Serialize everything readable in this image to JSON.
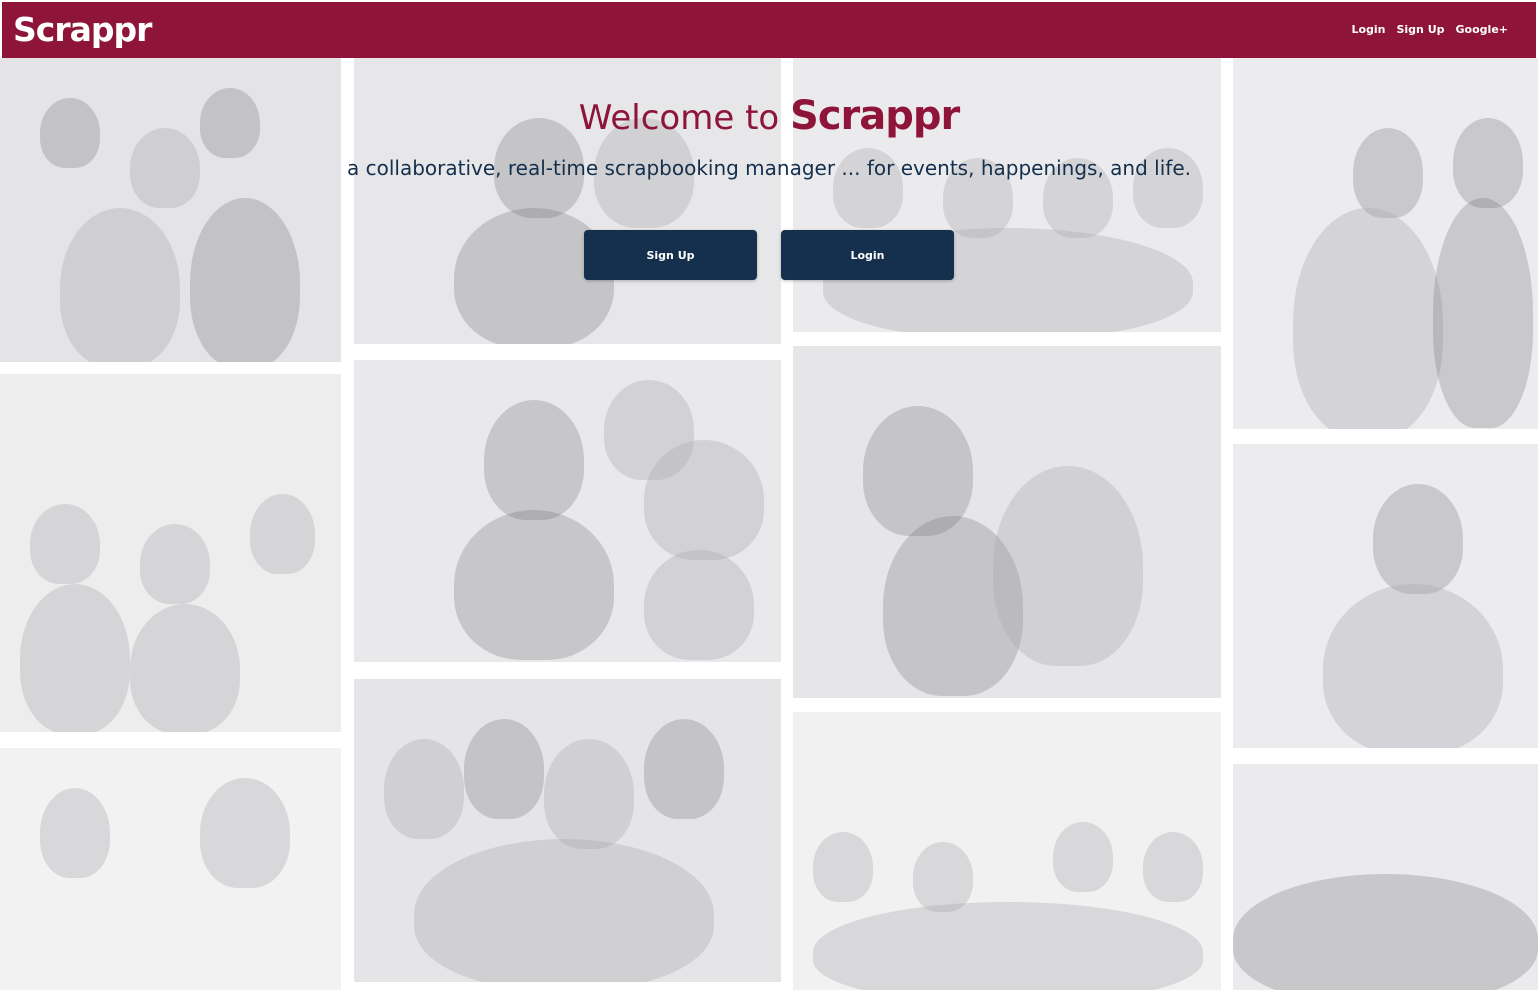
{
  "navbar": {
    "logo": "Scrappr",
    "brand_color": "#8f1439",
    "links": [
      {
        "label": "Login"
      },
      {
        "label": "Sign Up"
      },
      {
        "label": "Google+"
      }
    ]
  },
  "hero": {
    "title_prefix": "Welcome to ",
    "title_brand": "Scrappr",
    "subtitle": "a collaborative, real-time scrapbooking manager ... for events, happenings, and life.",
    "signup_label": "Sign Up",
    "login_label": "Login",
    "button_color": "#14304d"
  }
}
